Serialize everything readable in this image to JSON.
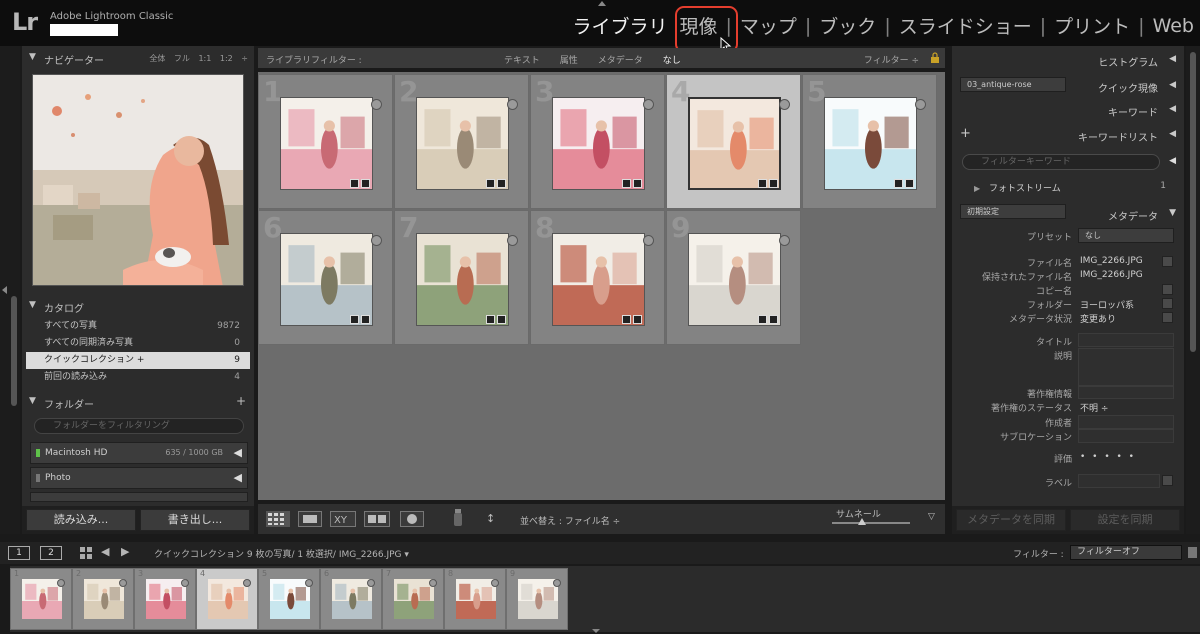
{
  "app": {
    "logo": "Lr",
    "name": "Adobe Lightroom Classic"
  },
  "modules": [
    {
      "label": "ライブラリ",
      "active": true
    },
    {
      "label": "現像",
      "highlighted": true
    },
    {
      "label": "マップ"
    },
    {
      "label": "ブック"
    },
    {
      "label": "スライドショー"
    },
    {
      "label": "プリント"
    },
    {
      "label": "Web"
    }
  ],
  "module_separator": "|",
  "navigator": {
    "title": "ナビゲーター",
    "controls": "全体 フル 1:1 1:2 ÷"
  },
  "catalog": {
    "title": "カタログ",
    "items": [
      {
        "label": "すべての写真",
        "count": "9872"
      },
      {
        "label": "すべての同期済み写真",
        "count": "0"
      },
      {
        "label": "クイックコレクション +",
        "count": "9",
        "selected": true
      },
      {
        "label": "前回の読み込み",
        "count": "4"
      }
    ]
  },
  "folders": {
    "title": "フォルダー",
    "add": "+",
    "search_placeholder": "フォルダーをフィルタリング",
    "volumes": [
      {
        "name": "Macintosh HD",
        "capacity": "635 / 1000 GB",
        "status_color": "#5fc24a"
      },
      {
        "name": "Photo",
        "capacity": "",
        "status_color": "#777777"
      }
    ]
  },
  "left_buttons": {
    "import": "読み込み...",
    "export": "書き出し..."
  },
  "library_filter": {
    "label": "ライブラリフィルター :",
    "tabs": [
      "テキスト",
      "属性",
      "メタデータ",
      "なし"
    ],
    "active_tab": "なし",
    "preset": "フィルター ÷"
  },
  "grid": {
    "cells": [
      {
        "num": "1",
        "palette": [
          "#e9a8b4",
          "#f4f0ea",
          "#c86a74"
        ]
      },
      {
        "num": "2",
        "palette": [
          "#d9cdb8",
          "#efe7da",
          "#9a8a76"
        ]
      },
      {
        "num": "3",
        "palette": [
          "#e58c9a",
          "#f6eef0",
          "#c34f63"
        ]
      },
      {
        "num": "4",
        "palette": [
          "#e4c8b2",
          "#f3e8de",
          "#e48a6a"
        ],
        "selected": true
      },
      {
        "num": "5",
        "palette": [
          "#c8e6ee",
          "#f8fbfc",
          "#7a4a3a"
        ]
      },
      {
        "num": "6",
        "palette": [
          "#b6c2c8",
          "#efeae0",
          "#7d7a62"
        ]
      },
      {
        "num": "7",
        "palette": [
          "#8ea27a",
          "#e9e2d4",
          "#b86c52"
        ]
      },
      {
        "num": "8",
        "palette": [
          "#c06a56",
          "#f1ede6",
          "#d89e8c"
        ]
      },
      {
        "num": "9",
        "palette": [
          "#d9d6cf",
          "#f5f1ea",
          "#b58e80"
        ]
      }
    ]
  },
  "toolbar": {
    "sort_label": "並べ替え :",
    "sort_value": "ファイル名 ÷",
    "thumbnail_label": "サムネール",
    "thumbnail_size": 0.38
  },
  "right": {
    "histogram": "ヒストグラム",
    "quick_develop": "クイック現像",
    "quick_preset": "03_antique-rose",
    "keyword": "キーワード",
    "keyword_list": "キーワードリスト",
    "keyword_add": "+",
    "keyword_search_placeholder": "フィルターキーワード",
    "photostream": "フォトストリーム",
    "photostream_count": "1",
    "metadata_preset": "初期設定",
    "metadata": "メタデータ",
    "preset_label": "プリセット",
    "preset_value": "なし",
    "fields": [
      {
        "label": "ファイル名",
        "value": "IMG_2266.JPG"
      },
      {
        "label": "保持されたファイル名",
        "value": "IMG_2266.JPG"
      },
      {
        "label": "コピー名",
        "value": ""
      },
      {
        "label": "フォルダー",
        "value": "ヨーロッパ系"
      },
      {
        "label": "メタデータ状況",
        "value": "変更あり"
      }
    ],
    "title_label": "タイトル",
    "caption_label": "説明",
    "copyright_label": "著作権情報",
    "copyright_status_label": "著作権のステータス",
    "copyright_status_value": "不明 ÷",
    "creator_label": "作成者",
    "sublocation_label": "サブロケーション",
    "rating_label": "評価",
    "rating_value": "• • • • •",
    "label_label": "ラベル",
    "sync_metadata": "メタデータを同期",
    "sync_settings": "設定を同期"
  },
  "filmstrip": {
    "screen1": "1",
    "screen2": "2",
    "source": "クイックコレクション  9 枚の写真/ 1 枚選択/ IMG_2266.JPG ▾",
    "filter_label": "フィルター :",
    "filter_value": "フィルターオフ",
    "selected_index": 3
  },
  "colors": {
    "highlight": "#e53e2e",
    "selected_cell": "#c4c4c4",
    "grid_bg": "#6c6c6c"
  }
}
